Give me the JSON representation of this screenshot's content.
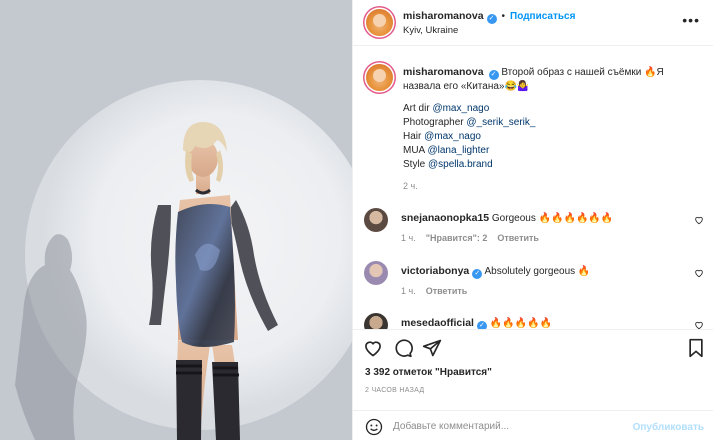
{
  "post": {
    "username": "misharomanova",
    "follow_label": "Подписаться",
    "dot": "•",
    "location": "Kyiv, Ukraine",
    "more_label": "•••"
  },
  "caption": {
    "username": "misharomanova",
    "text": "Второй образ с нашей съёмки 🔥Я назвала его «Китана»😂🤷‍♀️",
    "credits": [
      {
        "role": "Art dir ",
        "handle": "@max_nago"
      },
      {
        "role": "Photographer ",
        "handle": "@_serik_serik_"
      },
      {
        "role": "Hair ",
        "handle": "@max_nago"
      },
      {
        "role": "MUA ",
        "handle": "@lana_lighter"
      },
      {
        "role": "Style ",
        "handle": "@spella.brand"
      }
    ],
    "time": "2 ч."
  },
  "comments": [
    {
      "username": "snejanaonopka15",
      "verified": false,
      "text": "Gorgeous 🔥🔥🔥🔥🔥🔥",
      "time": "1 ч.",
      "likes": "\"Нравится\": 2",
      "reply": "Ответить"
    },
    {
      "username": "victoriabonya",
      "verified": true,
      "text": "Absolutely gorgeous 🔥",
      "time": "1 ч.",
      "likes": "",
      "reply": "Ответить"
    },
    {
      "username": "mesedaofficial",
      "verified": true,
      "text": "🔥🔥🔥🔥🔥",
      "time": "",
      "likes": "",
      "reply": ""
    }
  ],
  "likes": {
    "count": "3 392 отметок",
    "label": "\"Нравится\""
  },
  "time_ago": "2 ЧАСОВ НАЗАД",
  "composer": {
    "placeholder": "Добавьте комментарий...",
    "publish_label": "Опубликовать"
  },
  "colors": {
    "accent": "#0095f6",
    "verified": "#3897f0",
    "publish_disabled": "#b2dffc",
    "muted": "#8e8e8e"
  },
  "icons": [
    "heart-icon",
    "comment-icon",
    "share-icon",
    "bookmark-icon",
    "emoji-icon",
    "verified-icon"
  ]
}
